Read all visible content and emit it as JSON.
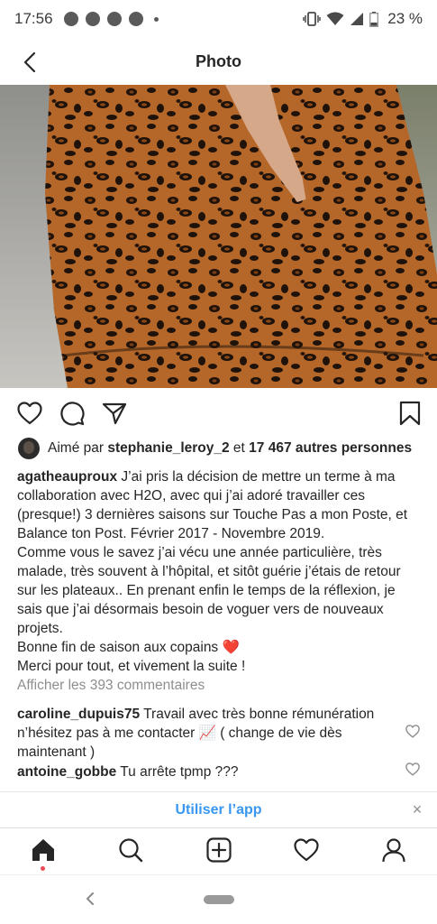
{
  "status_bar": {
    "time": "17:56",
    "battery": "23 %",
    "icons": [
      "whatsapp-icon",
      "chrome-icon",
      "chrome-icon",
      "chrome-icon",
      "notification-dot",
      "vibrate-icon",
      "wifi-icon",
      "signal-icon",
      "battery-icon"
    ]
  },
  "header": {
    "title": "Photo",
    "back_icon": "chevron-left-icon"
  },
  "post": {
    "actions": [
      "heart-icon",
      "comment-icon",
      "share-icon",
      "bookmark-icon"
    ],
    "likes": {
      "prefix": "Aimé par",
      "liker": "stephanie_leroy_2",
      "connector": "et",
      "others": "17 467 autres personnes"
    },
    "caption": {
      "user": "agatheauproux",
      "p1": "J’ai pris la décision de mettre un terme à ma collaboration avec H2O, avec qui j’ai adoré travailler ces (presque!) 3 dernières saisons sur Touche Pas a mon Poste, et Balance ton Post. Février 2017 - Novembre 2019.",
      "p2": "Comme vous le savez j’ai vécu une année particulière, très malade, très souvent à l’hôpital, et sitôt guérie j’étais de retour sur les plateaux.. En prenant enfin le temps de la réflexion, je sais que j’ai désormais besoin de voguer vers de nouveaux projets.",
      "p3": "Bonne fin de saison aux copains",
      "p3_emoji": "❤️",
      "p4": "Merci pour tout, et vivement la suite !"
    },
    "view_comments": "Afficher les 393 commentaires",
    "comments": [
      {
        "user": "caroline_dupuis75",
        "text": "Travail avec très bonne rémunération n’hésitez pas à me contacter 📈 ( change de vie dès maintenant )"
      },
      {
        "user": "antoine_gobbe",
        "text": "Tu arrête tpmp ???"
      }
    ]
  },
  "use_app": {
    "label": "Utiliser l’app",
    "close": "×"
  },
  "tabbar": [
    "home-icon",
    "search-icon",
    "add-post-icon",
    "activity-heart-icon",
    "profile-icon"
  ],
  "colors": {
    "link_blue": "#3897f0",
    "text": "#262626",
    "muted": "#8e8e8e",
    "notification_red": "#ed4956"
  }
}
